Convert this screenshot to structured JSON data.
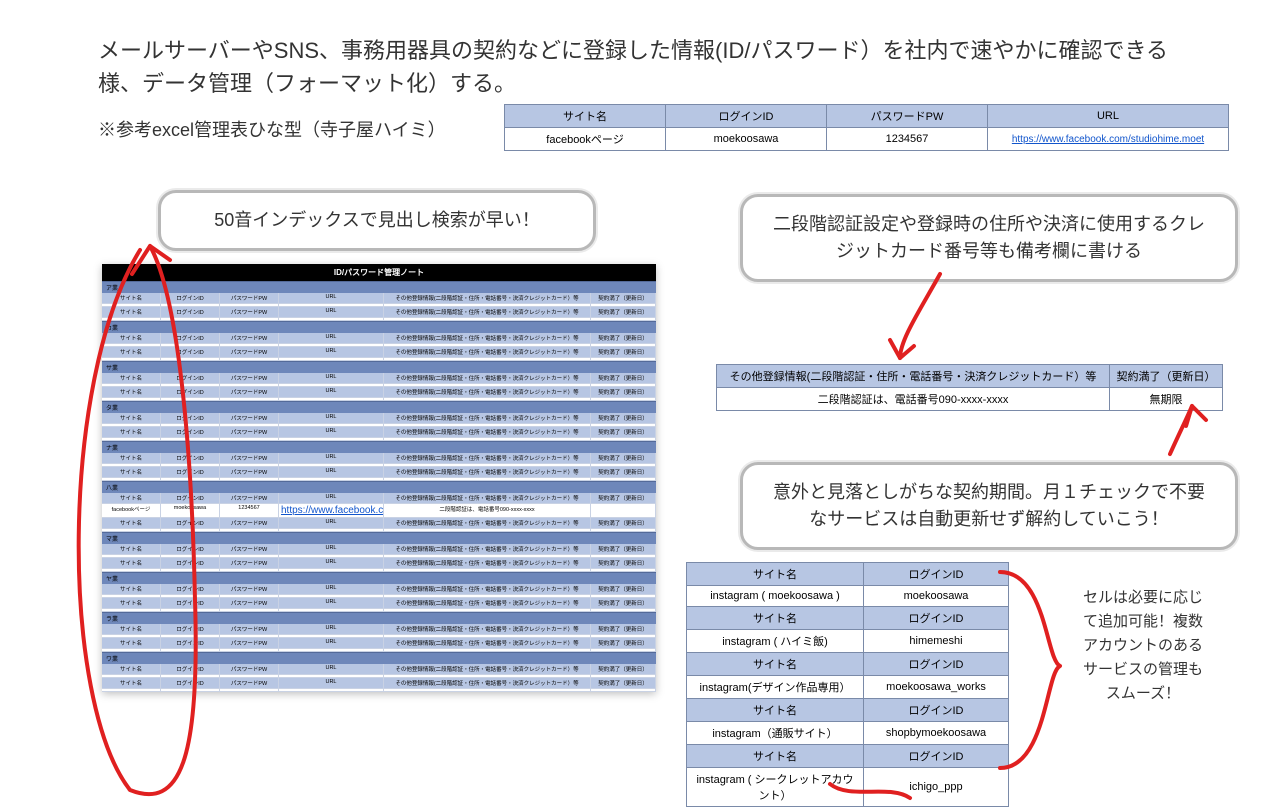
{
  "heading": "メールサーバーやSNS、事務用器具の契約などに登録した情報(ID/パスワード）を社内で速やかに確認できる様、データ管理（フォーマット化）する。",
  "subnote": "※参考excel管理表ひな型（寺子屋ハイミ）",
  "topTable": {
    "headers": [
      "サイト名",
      "ログインID",
      "パスワードPW",
      "URL"
    ],
    "row": {
      "site": "facebookページ",
      "login": "moekoosawa",
      "pw": "1234567",
      "url": "https://www.facebook.com/studiohime.moet"
    }
  },
  "bubble1": "50音インデックスで見出し検索が早い！",
  "bubble2": "二段階認証設定や登録時の住所や決済に使用するクレジットカード番号等も備考欄に書ける",
  "bubble3": "意外と見落としがちな契約期間。月１チェックで不要なサービスは自動更新せず解約していこう！",
  "otherTable": {
    "h1": "その他登録情報(二段階認証・住所・電話番号・決済クレジットカード）等",
    "h2": "契約満了（更新日）",
    "v1": "二段階認証は、電話番号090-xxxx-xxxx",
    "v2": "無期限"
  },
  "acct": {
    "hSite": "サイト名",
    "hLogin": "ログインID",
    "rows": [
      {
        "site": "instagram ( moekoosawa )",
        "login": "moekoosawa"
      },
      {
        "site": "instagram ( ハイミ飯)",
        "login": "himemeshi"
      },
      {
        "site": "instagram(デザイン作品専用）",
        "login": "moekoosawa_works"
      },
      {
        "site": "instagram（通販サイト）",
        "login": "shopbymoekoosawa"
      },
      {
        "site": "instagram ( シークレットアカウント）",
        "login": "ichigo_ppp"
      }
    ]
  },
  "sidenote": "セルは必要に応じて追加可能！複数アカウントのあるサービスの管理もスムーズ！",
  "sheet": {
    "title": "ID/パスワード管理ノート",
    "colHeaders": [
      "サイト名",
      "ログインID",
      "パスワードPW",
      "URL",
      "その他登録情報(二段階認証・住所・電話番号・決済クレジットカード）等",
      "契約満了（更新日）"
    ],
    "groups": [
      "ア業",
      "カ業",
      "サ業",
      "タ業",
      "ナ業",
      "八業",
      "マ業",
      "ヤ業",
      "ラ業",
      "ワ業"
    ],
    "sample": {
      "site": "サイト名",
      "login": "ログインID",
      "pw": "パスワードPW",
      "url": "URL",
      "other": "その他登録情報(二段階認証・住所・電話番号・決済クレジットカード）等",
      "exp": "契約満了（更新日）"
    },
    "fbRow": {
      "site": "facebookページ",
      "login": "moekoosawa",
      "pw": "1234567",
      "url": "https://www.facebook.com/studiohime.moet",
      "other": "二段階認証は、電話番号090-xxxx-xxxx",
      "exp": ""
    }
  }
}
